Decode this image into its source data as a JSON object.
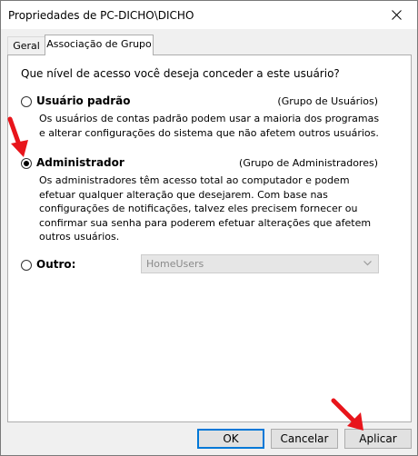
{
  "window": {
    "title": "Propriedades de PC-DICHO\\DICHO"
  },
  "tabs": [
    {
      "label": "Geral",
      "active": false
    },
    {
      "label": "Associação de Grupo",
      "active": true
    }
  ],
  "question": "Que nível de acesso você deseja conceder a este usuário?",
  "options": {
    "standard": {
      "label": "Usuário padrão",
      "group": "(Grupo de Usuários)",
      "desc_lines": [
        "Os usuários de contas padrão podem usar a maioria dos programas",
        "e alterar configurações do sistema que não afetem outros usuários."
      ],
      "checked": false
    },
    "admin": {
      "label": "Administrador",
      "group": "(Grupo de Administradores)",
      "desc_lines": [
        "Os administradores têm acesso total ao computador e podem",
        "efetuar qualquer alteração que desejarem. Com base nas",
        "configurações de notificações, talvez eles precisem fornecer ou",
        "confirmar sua senha para poderem efetuar alterações que afetem",
        "outros usuários."
      ],
      "checked": true
    },
    "other": {
      "label": "Outro:",
      "dropdown_value": "HomeUsers",
      "checked": false,
      "enabled": false
    }
  },
  "buttons": {
    "ok": "OK",
    "cancel": "Cancelar",
    "apply": "Aplicar"
  },
  "colors": {
    "annotation_arrow": "#e8151b",
    "focus_border": "#0078d7"
  }
}
